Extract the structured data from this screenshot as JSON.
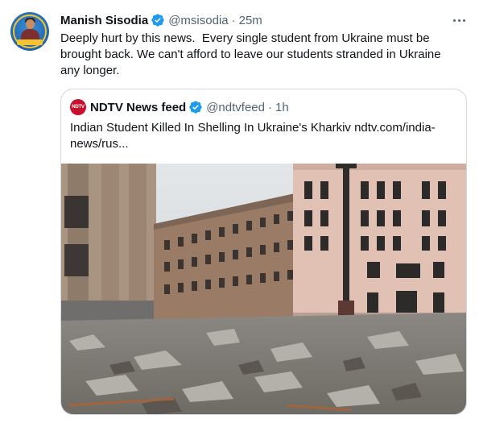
{
  "tweet": {
    "display_name": "Manish Sisodia",
    "handle": "@msisodia",
    "separator": "·",
    "time": "25m",
    "text": "Deeply hurt by this news.  Every single student from Ukraine must be brought back. We can't afford to leave our students stranded in Ukraine any longer.",
    "avatar_icon": "profile-avatar",
    "verified_icon": "verified-badge-icon",
    "more_icon": "more-options-icon",
    "accent_color": "#1d9bf0"
  },
  "quote": {
    "display_name": "NDTV News feed",
    "handle": "@ndtvfeed",
    "separator": "·",
    "time": "1h",
    "logo_text": "NDTV",
    "text": "Indian Student Killed In Shelling In Ukraine's Kharkiv ndtv.com/india-news/rus...",
    "photo_icon": "news-photo-shelled-city-square",
    "logo_color": "#c8102e"
  }
}
